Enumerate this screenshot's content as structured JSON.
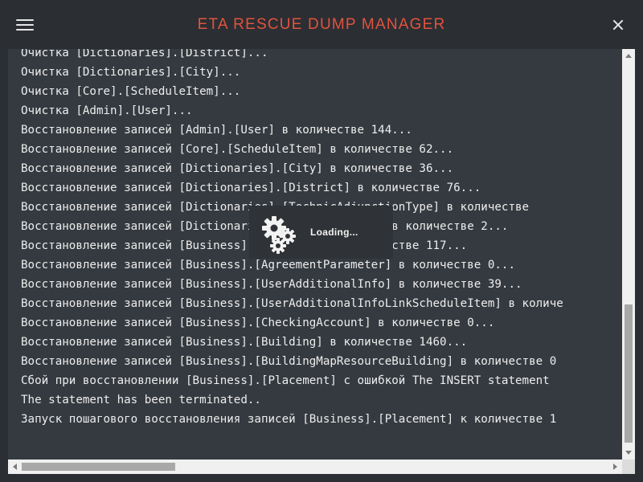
{
  "header": {
    "title": "ETA RESCUE DUMP MANAGER",
    "menu_icon": "hamburger-menu-icon",
    "close_icon": "close-icon"
  },
  "log": {
    "lines": [
      "Очистка [Dictionaries].[District]...",
      "Очистка [Dictionaries].[City]...",
      "Очистка [Core].[ScheduleItem]...",
      "Очистка [Admin].[User]...",
      "Восстановление записей [Admin].[User] в количестве 144...",
      "Восстановление записей [Core].[ScheduleItem] в количестве 62...",
      "Восстановление записей [Dictionaries].[City] в количестве 36...",
      "Восстановление записей [Dictionaries].[District] в количестве 76...",
      "Восстановление записей [Dictionaries].[TechnicAdjunctionType] в количестве",
      "Восстановление записей [Dictionaries].[ParameterType] в количестве 2...",
      "Восстановление записей [Business].[Agreement] в количестве 117...",
      "Восстановление записей [Business].[AgreementParameter] в количестве 0...",
      "Восстановление записей [Business].[UserAdditionalInfo] в количестве 39...",
      "Восстановление записей [Business].[UserAdditionalInfoLinkScheduleItem] в количе",
      "Восстановление записей [Business].[CheckingAccount] в количестве 0...",
      "Восстановление записей [Business].[Building] в количестве 1460...",
      "Восстановление записей [Business].[BuildingMapResourceBuilding] в количестве 0",
      "Сбой при восстановлении [Business].[Placement] с ошибкой The INSERT statement",
      "The statement has been terminated..",
      "Запуск пошагового восстановления записей [Business].[Placement] к количестве 1"
    ]
  },
  "loading": {
    "label": "Loading...",
    "icon": "gears-icon"
  },
  "colors": {
    "title": "#e2533e",
    "background": "#2b2e33",
    "log_background": "#353a40",
    "log_text": "#ededed"
  }
}
